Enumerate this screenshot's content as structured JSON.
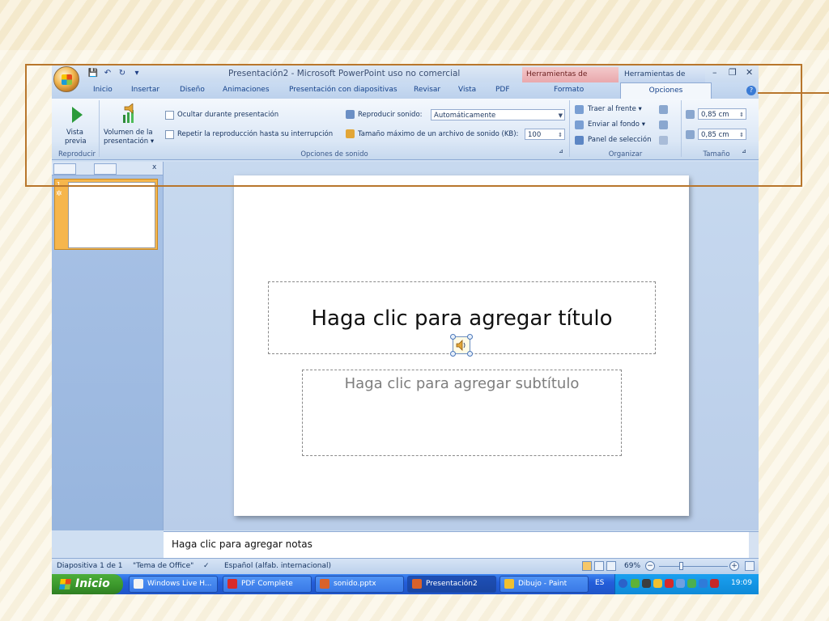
{
  "window": {
    "title": "Presentación2 - Microsoft PowerPoint uso no comercial",
    "context_tabs": {
      "image_tools": "Herramientas de imagen",
      "sound_tools": "Herramientas de so..."
    },
    "controls": {
      "minimize": "–",
      "restore": "❐",
      "close": "✕"
    }
  },
  "quick_access": {
    "save": "💾",
    "undo": "↶",
    "redo": "↻",
    "more": "▾"
  },
  "tabs": [
    "Inicio",
    "Insertar",
    "Diseño",
    "Animaciones",
    "Presentación con diapositivas",
    "Revisar",
    "Vista",
    "PDF"
  ],
  "context_tab_labels": {
    "formato": "Formato",
    "opciones": "Opciones"
  },
  "ribbon": {
    "reproducir": {
      "preview_label": [
        "Vista",
        "previa"
      ],
      "group": "Reproducir"
    },
    "opciones_sonido": {
      "volume_label": [
        "Volumen de la",
        "presentación ▾"
      ],
      "hide_during": "Ocultar durante presentación",
      "loop": "Repetir la reproducción hasta su interrupción",
      "play_sound_label": "Reproducir sonido:",
      "play_sound_value": "Automáticamente",
      "max_size_label": "Tamaño máximo de un archivo de sonido (KB):",
      "max_size_value": "100",
      "group": "Opciones de sonido"
    },
    "organizar": {
      "bring_front": "Traer al frente ▾",
      "send_back": "Enviar al fondo ▾",
      "selection_pane": "Panel de selección",
      "group": "Organizar"
    },
    "tamano": {
      "height": "0,85 cm",
      "width": "0,85 cm",
      "group": "Tamaño"
    }
  },
  "left_pane": {
    "slide_number": "1",
    "close": "x"
  },
  "slide": {
    "title_placeholder": "Haga clic para agregar título",
    "subtitle_placeholder": "Haga clic para agregar subtítulo"
  },
  "notes": {
    "placeholder": "Haga clic para agregar notas"
  },
  "status": {
    "slide_info": "Diapositiva 1 de 1",
    "theme": "\"Tema de Office\"",
    "language": "Español (alfab. internacional)",
    "zoom": "69%"
  },
  "taskbar": {
    "start": "Inicio",
    "items": [
      "Windows Live H...",
      "PDF Complete",
      "sonido.pptx",
      "Presentación2",
      "Dibujo - Paint"
    ],
    "lang": "ES",
    "clock": "19:09"
  }
}
